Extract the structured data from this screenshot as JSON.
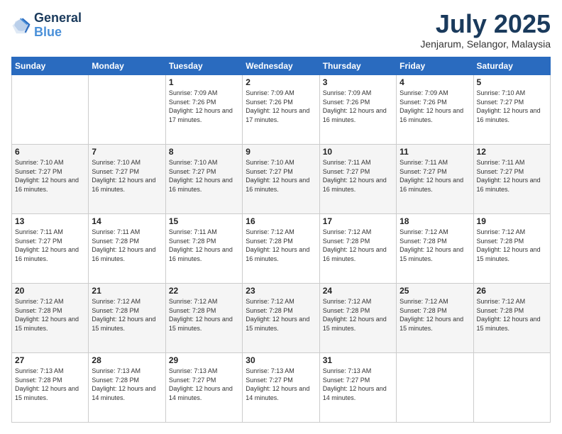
{
  "logo": {
    "line1": "General",
    "line2": "Blue"
  },
  "title": "July 2025",
  "location": "Jenjarum, Selangor, Malaysia",
  "days_of_week": [
    "Sunday",
    "Monday",
    "Tuesday",
    "Wednesday",
    "Thursday",
    "Friday",
    "Saturday"
  ],
  "weeks": [
    [
      {
        "day": "",
        "info": ""
      },
      {
        "day": "",
        "info": ""
      },
      {
        "day": "1",
        "info": "Sunrise: 7:09 AM\nSunset: 7:26 PM\nDaylight: 12 hours and 17 minutes."
      },
      {
        "day": "2",
        "info": "Sunrise: 7:09 AM\nSunset: 7:26 PM\nDaylight: 12 hours and 17 minutes."
      },
      {
        "day": "3",
        "info": "Sunrise: 7:09 AM\nSunset: 7:26 PM\nDaylight: 12 hours and 16 minutes."
      },
      {
        "day": "4",
        "info": "Sunrise: 7:09 AM\nSunset: 7:26 PM\nDaylight: 12 hours and 16 minutes."
      },
      {
        "day": "5",
        "info": "Sunrise: 7:10 AM\nSunset: 7:27 PM\nDaylight: 12 hours and 16 minutes."
      }
    ],
    [
      {
        "day": "6",
        "info": "Sunrise: 7:10 AM\nSunset: 7:27 PM\nDaylight: 12 hours and 16 minutes."
      },
      {
        "day": "7",
        "info": "Sunrise: 7:10 AM\nSunset: 7:27 PM\nDaylight: 12 hours and 16 minutes."
      },
      {
        "day": "8",
        "info": "Sunrise: 7:10 AM\nSunset: 7:27 PM\nDaylight: 12 hours and 16 minutes."
      },
      {
        "day": "9",
        "info": "Sunrise: 7:10 AM\nSunset: 7:27 PM\nDaylight: 12 hours and 16 minutes."
      },
      {
        "day": "10",
        "info": "Sunrise: 7:11 AM\nSunset: 7:27 PM\nDaylight: 12 hours and 16 minutes."
      },
      {
        "day": "11",
        "info": "Sunrise: 7:11 AM\nSunset: 7:27 PM\nDaylight: 12 hours and 16 minutes."
      },
      {
        "day": "12",
        "info": "Sunrise: 7:11 AM\nSunset: 7:27 PM\nDaylight: 12 hours and 16 minutes."
      }
    ],
    [
      {
        "day": "13",
        "info": "Sunrise: 7:11 AM\nSunset: 7:27 PM\nDaylight: 12 hours and 16 minutes."
      },
      {
        "day": "14",
        "info": "Sunrise: 7:11 AM\nSunset: 7:28 PM\nDaylight: 12 hours and 16 minutes."
      },
      {
        "day": "15",
        "info": "Sunrise: 7:11 AM\nSunset: 7:28 PM\nDaylight: 12 hours and 16 minutes."
      },
      {
        "day": "16",
        "info": "Sunrise: 7:12 AM\nSunset: 7:28 PM\nDaylight: 12 hours and 16 minutes."
      },
      {
        "day": "17",
        "info": "Sunrise: 7:12 AM\nSunset: 7:28 PM\nDaylight: 12 hours and 16 minutes."
      },
      {
        "day": "18",
        "info": "Sunrise: 7:12 AM\nSunset: 7:28 PM\nDaylight: 12 hours and 15 minutes."
      },
      {
        "day": "19",
        "info": "Sunrise: 7:12 AM\nSunset: 7:28 PM\nDaylight: 12 hours and 15 minutes."
      }
    ],
    [
      {
        "day": "20",
        "info": "Sunrise: 7:12 AM\nSunset: 7:28 PM\nDaylight: 12 hours and 15 minutes."
      },
      {
        "day": "21",
        "info": "Sunrise: 7:12 AM\nSunset: 7:28 PM\nDaylight: 12 hours and 15 minutes."
      },
      {
        "day": "22",
        "info": "Sunrise: 7:12 AM\nSunset: 7:28 PM\nDaylight: 12 hours and 15 minutes."
      },
      {
        "day": "23",
        "info": "Sunrise: 7:12 AM\nSunset: 7:28 PM\nDaylight: 12 hours and 15 minutes."
      },
      {
        "day": "24",
        "info": "Sunrise: 7:12 AM\nSunset: 7:28 PM\nDaylight: 12 hours and 15 minutes."
      },
      {
        "day": "25",
        "info": "Sunrise: 7:12 AM\nSunset: 7:28 PM\nDaylight: 12 hours and 15 minutes."
      },
      {
        "day": "26",
        "info": "Sunrise: 7:12 AM\nSunset: 7:28 PM\nDaylight: 12 hours and 15 minutes."
      }
    ],
    [
      {
        "day": "27",
        "info": "Sunrise: 7:13 AM\nSunset: 7:28 PM\nDaylight: 12 hours and 15 minutes."
      },
      {
        "day": "28",
        "info": "Sunrise: 7:13 AM\nSunset: 7:28 PM\nDaylight: 12 hours and 14 minutes."
      },
      {
        "day": "29",
        "info": "Sunrise: 7:13 AM\nSunset: 7:27 PM\nDaylight: 12 hours and 14 minutes."
      },
      {
        "day": "30",
        "info": "Sunrise: 7:13 AM\nSunset: 7:27 PM\nDaylight: 12 hours and 14 minutes."
      },
      {
        "day": "31",
        "info": "Sunrise: 7:13 AM\nSunset: 7:27 PM\nDaylight: 12 hours and 14 minutes."
      },
      {
        "day": "",
        "info": ""
      },
      {
        "day": "",
        "info": ""
      }
    ]
  ]
}
